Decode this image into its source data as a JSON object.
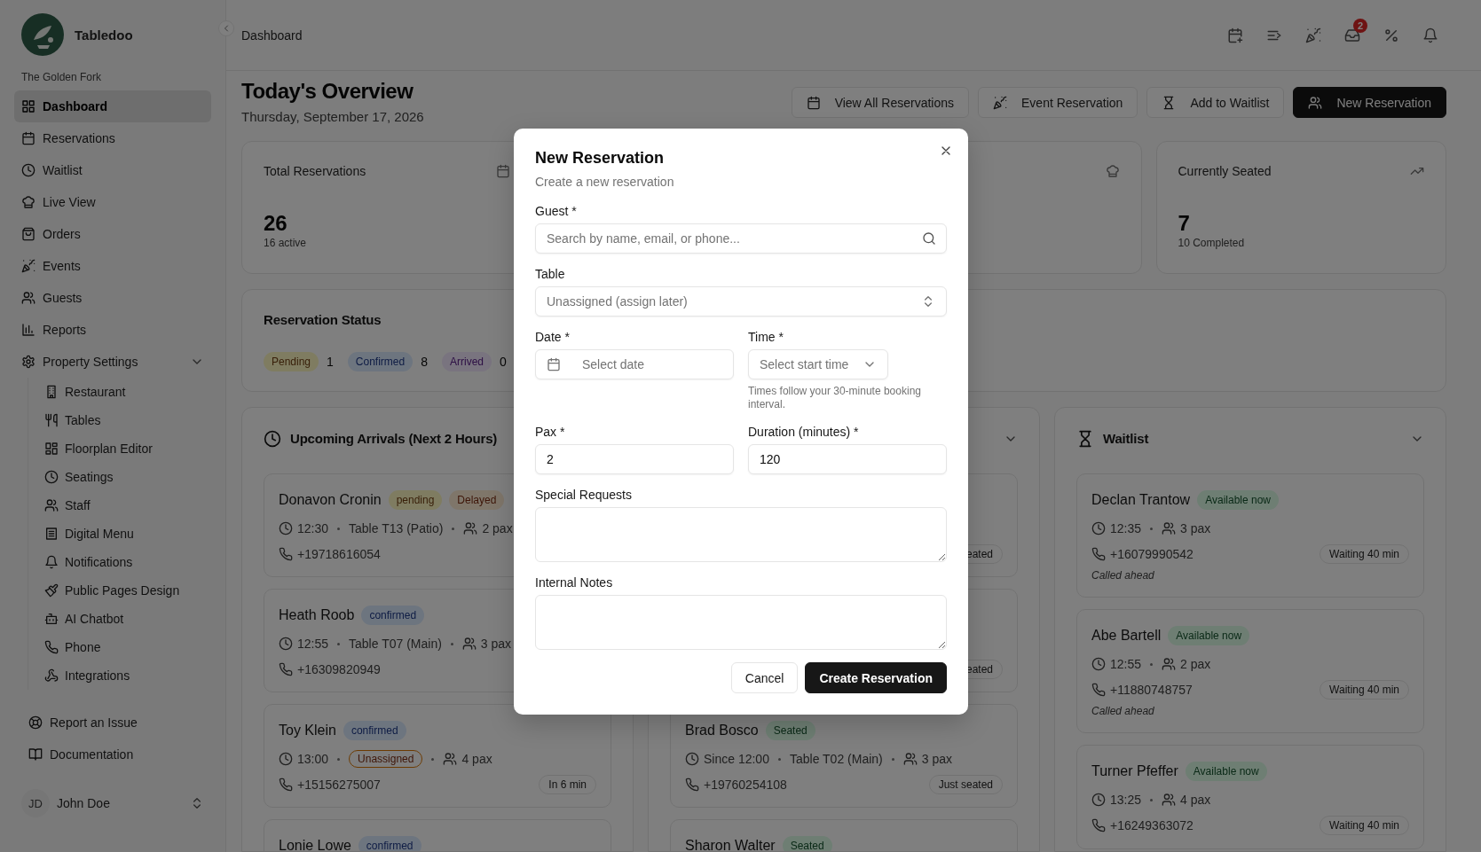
{
  "sidebar": {
    "brand": "Tabledoo",
    "venue": "The Golden Fork",
    "nav": [
      {
        "label": "Dashboard",
        "selected": true
      },
      {
        "label": "Reservations",
        "selected": false
      },
      {
        "label": "Waitlist",
        "selected": false
      },
      {
        "label": "Live View",
        "selected": false
      },
      {
        "label": "Orders",
        "selected": false
      },
      {
        "label": "Events",
        "selected": false
      },
      {
        "label": "Guests",
        "selected": false
      },
      {
        "label": "Reports",
        "selected": false
      },
      {
        "label": "Property Settings",
        "selected": false,
        "expanded": true,
        "children": [
          {
            "label": "Restaurant",
            "selected": false
          },
          {
            "label": "Tables",
            "selected": false
          },
          {
            "label": "Floorplan Editor",
            "selected": false
          },
          {
            "label": "Seatings",
            "selected": false
          },
          {
            "label": "Staff",
            "selected": false
          },
          {
            "label": "Digital Menu",
            "selected": false
          },
          {
            "label": "Notifications",
            "selected": false
          },
          {
            "label": "Public Pages Design",
            "selected": false
          },
          {
            "label": "AI Chatbot",
            "selected": false
          },
          {
            "label": "Phone",
            "selected": false
          },
          {
            "label": "Integrations",
            "selected": false
          }
        ]
      }
    ],
    "links": [
      {
        "label": "Report an Issue"
      },
      {
        "label": "Documentation"
      }
    ],
    "user": {
      "initials": "JD",
      "name": "John Doe"
    }
  },
  "header": {
    "breadcrumb": "Dashboard",
    "inbox_count": "2"
  },
  "overview": {
    "title": "Today's Overview",
    "date": "Thursday, September 17, 2026",
    "actions": [
      {
        "label": "View All Reservations",
        "primary": false
      },
      {
        "label": "Event Reservation",
        "primary": false
      },
      {
        "label": "Add to Waitlist",
        "primary": false
      },
      {
        "label": "New Reservation",
        "primary": true
      }
    ]
  },
  "stats": [
    {
      "kind": "full",
      "label": "Total Reservations",
      "value": "26",
      "note": "16 active"
    },
    {
      "kind": "icon-only"
    },
    {
      "kind": "full",
      "label": "Currently Seated",
      "value": "7",
      "note": "10 Completed"
    }
  ],
  "status": {
    "title": "Reservation Status",
    "items": [
      {
        "label": "Pending",
        "count": "1",
        "kind": "pending"
      },
      {
        "label": "Confirmed",
        "count": "8",
        "kind": "confirmed"
      },
      {
        "label": "Arrived",
        "count": "0",
        "kind": "arrived"
      }
    ]
  },
  "arrivals": {
    "title": "Upcoming Arrivals (Next 2 Hours)",
    "cards": [
      {
        "name": "Donavon Cronin",
        "badges": [
          {
            "label": "pending",
            "kind": "pending"
          },
          {
            "label": "Delayed",
            "kind": "delayed"
          }
        ],
        "meta": [
          {
            "kind": "time",
            "text": "12:30"
          },
          {
            "kind": "text",
            "text": "Table T13 (Patio)"
          },
          {
            "kind": "pax",
            "text": "2 pax"
          }
        ],
        "phone": "+19718616054"
      },
      {
        "name": "Heath Roob",
        "badges": [
          {
            "label": "confirmed",
            "kind": "confirmed"
          }
        ],
        "meta": [
          {
            "kind": "time",
            "text": "12:55"
          },
          {
            "kind": "text",
            "text": "Table T07 (Main)"
          },
          {
            "kind": "pax",
            "text": "3 pax"
          }
        ],
        "phone": "+16309820949"
      },
      {
        "name": "Toy Klein",
        "badges": [
          {
            "label": "confirmed",
            "kind": "confirmed"
          }
        ],
        "meta": [
          {
            "kind": "time",
            "text": "13:00"
          },
          {
            "kind": "warning",
            "text": "Unassigned"
          },
          {
            "kind": "pax",
            "text": "4 pax"
          }
        ],
        "phone": "+15156275007",
        "tag": "In 6 min"
      },
      {
        "name": "Lonie Lowe",
        "badges": [
          {
            "label": "confirmed",
            "kind": "confirmed"
          }
        ]
      }
    ]
  },
  "seated": {
    "cards": [
      {
        "tag": "eated"
      },
      {
        "tag": "eated"
      },
      {
        "name": "Brad Bosco",
        "badges": [
          {
            "label": "Seated",
            "kind": "seated"
          }
        ],
        "meta": [
          {
            "kind": "time",
            "text": "Since 12:00"
          },
          {
            "kind": "text",
            "text": "Table T02 (Main)"
          },
          {
            "kind": "pax",
            "text": "3 pax"
          }
        ],
        "phone": "+19760254108",
        "tag": "Just seated"
      },
      {
        "name": "Sharon Walter",
        "badges": [
          {
            "label": "Seated",
            "kind": "seated"
          }
        ]
      }
    ]
  },
  "waitlist": {
    "title": "Waitlist",
    "cards": [
      {
        "name": "Declan Trantow",
        "badges": [
          {
            "label": "Available now",
            "kind": "seated"
          }
        ],
        "meta": [
          {
            "kind": "time",
            "text": "12:35"
          },
          {
            "kind": "pax",
            "text": "3 pax"
          }
        ],
        "phone": "+16079990542",
        "tag": "Waiting 40 min",
        "note": "Called ahead"
      },
      {
        "name": "Abe Bartell",
        "badges": [
          {
            "label": "Available now",
            "kind": "seated"
          }
        ],
        "meta": [
          {
            "kind": "time",
            "text": "12:55"
          },
          {
            "kind": "pax",
            "text": "2 pax"
          }
        ],
        "phone": "+11880748757",
        "tag": "Waiting 40 min",
        "note": "Called ahead"
      },
      {
        "name": "Turner Pfeffer",
        "badges": [
          {
            "label": "Available now",
            "kind": "seated"
          }
        ],
        "meta": [
          {
            "kind": "time",
            "text": "13:25"
          },
          {
            "kind": "pax",
            "text": "4 pax"
          }
        ],
        "phone": "+16249363072",
        "tag": "Waiting 40 min"
      }
    ]
  },
  "modal": {
    "title": "New Reservation",
    "subtitle": "Create a new reservation",
    "guest": {
      "label": "Guest *",
      "placeholder": "Search by name, email, or phone..."
    },
    "table": {
      "label": "Table",
      "placeholder": "Unassigned (assign later)"
    },
    "date": {
      "label": "Date *",
      "placeholder": "Select date"
    },
    "time": {
      "label": "Time *",
      "placeholder": "Select start time",
      "hint": "Times follow your 30-minute booking interval."
    },
    "pax": {
      "label": "Pax *",
      "value": "2"
    },
    "duration": {
      "label": "Duration (minutes) *",
      "value": "120"
    },
    "special_requests": {
      "label": "Special Requests"
    },
    "internal_notes": {
      "label": "Internal Notes"
    },
    "buttons": [
      {
        "label": "Cancel",
        "primary": false
      },
      {
        "label": "Create Reservation",
        "primary": true
      }
    ]
  }
}
